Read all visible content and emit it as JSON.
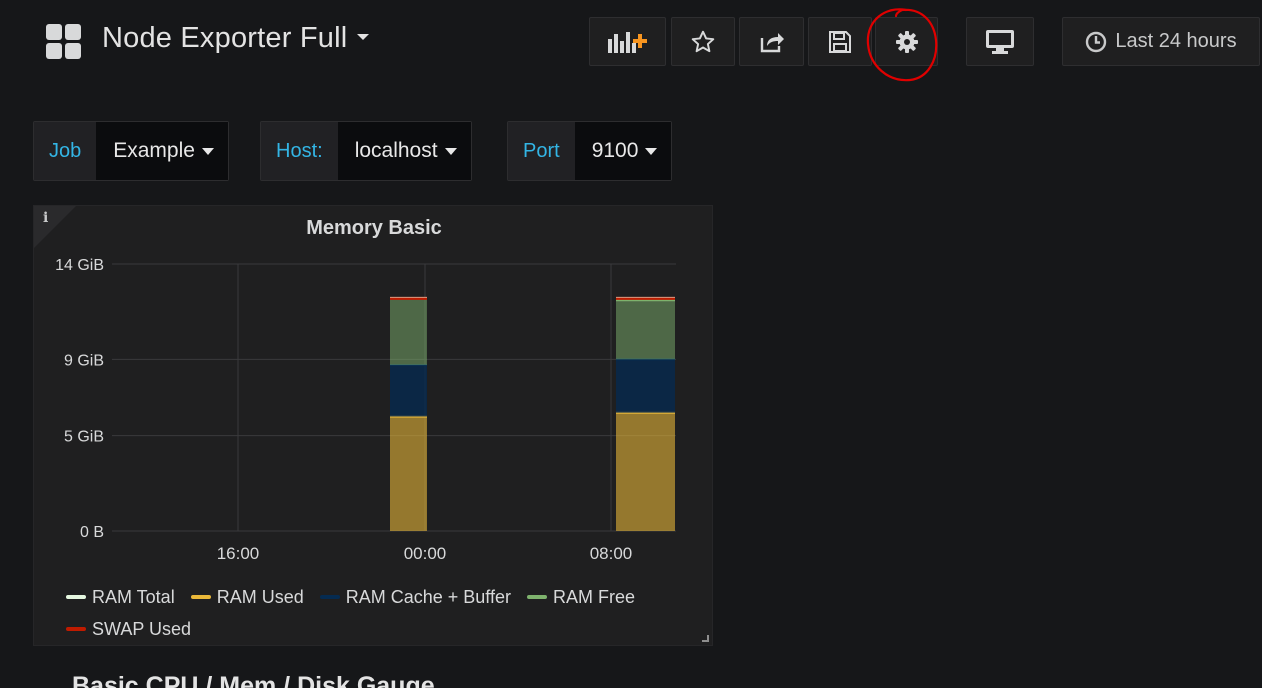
{
  "dashboard": {
    "title": "Node Exporter Full"
  },
  "toolbar": {
    "buttons": [
      {
        "name": "add-panel-button",
        "icon": "add-panel-icon"
      },
      {
        "name": "star-button",
        "icon": "star-icon"
      },
      {
        "name": "share-button",
        "icon": "share-icon"
      },
      {
        "name": "save-button",
        "icon": "save-icon"
      },
      {
        "name": "settings-button",
        "icon": "gear-icon"
      },
      {
        "name": "tv-mode-button",
        "icon": "monitor-icon"
      }
    ],
    "time_range": "Last 24 hours",
    "annotation_color": "#e00000"
  },
  "variables": [
    {
      "label": "Job",
      "value": "Example"
    },
    {
      "label": "Host:",
      "value": "localhost"
    },
    {
      "label": "Port",
      "value": "9100"
    }
  ],
  "panel": {
    "title": "Memory Basic",
    "info_icon": "i"
  },
  "chart_data": {
    "type": "area",
    "title": "Memory Basic",
    "y_unit": "GiB",
    "ylim": [
      0,
      14
    ],
    "y_ticks": [
      {
        "value": 0,
        "label": "0 B"
      },
      {
        "value": 5,
        "label": "5 GiB"
      },
      {
        "value": 9,
        "label": "9 GiB"
      },
      {
        "value": 14,
        "label": "14 GiB"
      }
    ],
    "x_ticks": [
      "16:00",
      "00:00",
      "08:00"
    ],
    "grid": true,
    "stacked": true,
    "segments": [
      {
        "ram_used": 6.0,
        "ram_cache_buffer": 2.7,
        "ram_free": 3.5,
        "swap_used": 0.1,
        "ram_total": 12.2
      },
      {
        "ram_used": 6.2,
        "ram_cache_buffer": 2.8,
        "ram_free": 3.1,
        "swap_used": 0.1,
        "ram_total": 12.2
      }
    ],
    "series": [
      {
        "name": "RAM Total",
        "color": "#e5f7e0"
      },
      {
        "name": "RAM Used",
        "color": "#eab839"
      },
      {
        "name": "RAM Cache + Buffer",
        "color": "#052b51"
      },
      {
        "name": "RAM Free",
        "color": "#7eb26d"
      },
      {
        "name": "SWAP Used",
        "color": "#bf1b00"
      }
    ],
    "legend_position": "bottom"
  },
  "next_row": {
    "title": "Basic CPU / Mem / Disk Gauge"
  }
}
